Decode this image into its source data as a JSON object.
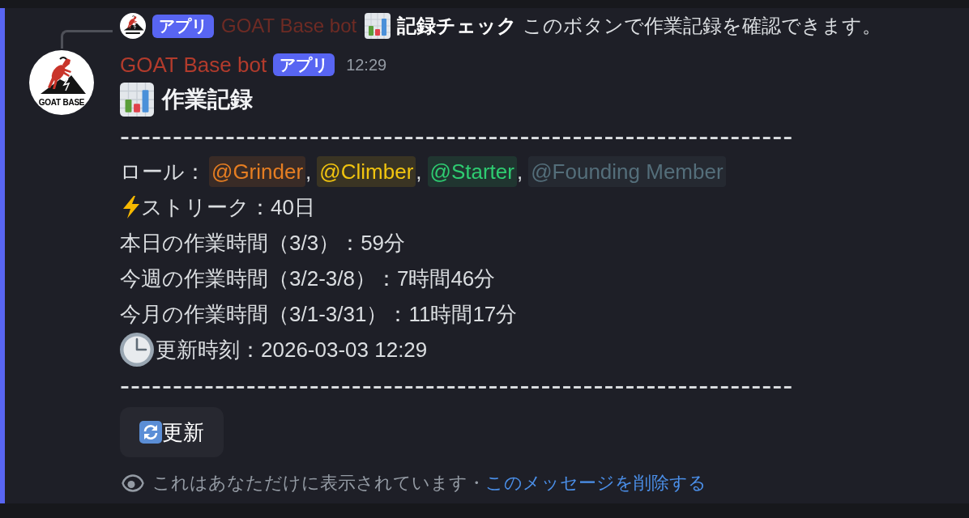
{
  "reply": {
    "author": "GOAT Base bot",
    "badge": "アプリ",
    "content": "**記録チェック** このボタンで作業記録を確認できます。"
  },
  "message": {
    "avatar_text": "GOAT BASE",
    "author": "GOAT Base bot",
    "badge": "アプリ",
    "timestamp": "12:29",
    "title": "作業記録",
    "separator_top": "----------------------------------------------------------------",
    "roles_label": "ロール：",
    "roles": [
      {
        "name": "@Grinder",
        "color": "#e67e22",
        "separator": ","
      },
      {
        "name": "@Climber",
        "color": "#f1c40f",
        "separator": ","
      },
      {
        "name": "@Starter",
        "color": "#2ecc71",
        "separator": ","
      },
      {
        "name": "@Founding Member",
        "color": "#546e7a"
      }
    ],
    "streak": "ストリーク：40日",
    "today": "本日の作業時間（3/3）：59分",
    "this_week": "今週の作業時間（3/2-3/8）：7時間46分",
    "this_month": "今月の作業時間（3/1-3/31）：11時間17分",
    "updated": "更新時刻：2026-03-03 12:29",
    "separator_bottom": "----------------------------------------------------------------",
    "button": "更新",
    "notice": "これはあなただけに表示されています・",
    "delete_link": "このメッセージを削除する"
  }
}
